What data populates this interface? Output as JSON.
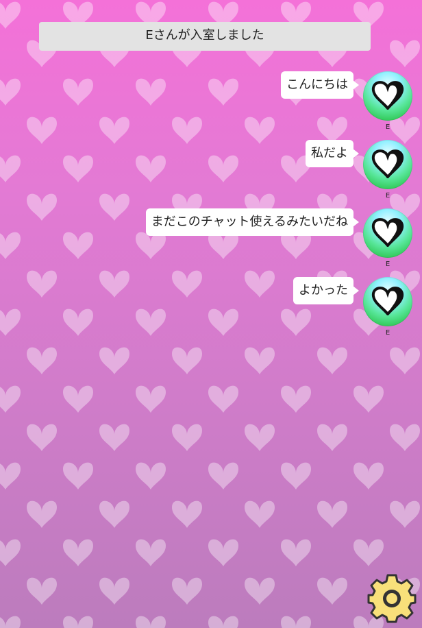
{
  "room": {
    "notice": "Eさんが入室しました"
  },
  "messages": [
    {
      "text": "こんにちは",
      "user": "E"
    },
    {
      "text": "私だよ",
      "user": "E"
    },
    {
      "text": "まだこのチャット使えるみたいだね",
      "user": "E"
    },
    {
      "text": "よかった",
      "user": "E"
    }
  ],
  "icons": {
    "avatar": "heart-icon",
    "settings": "gear-icon"
  },
  "colors": {
    "background_top": "#f471d8",
    "background_bottom": "#bc7cbd",
    "bubble": "#ffffff",
    "notice": "#e3e3e3",
    "gear": "#f8e07a"
  }
}
